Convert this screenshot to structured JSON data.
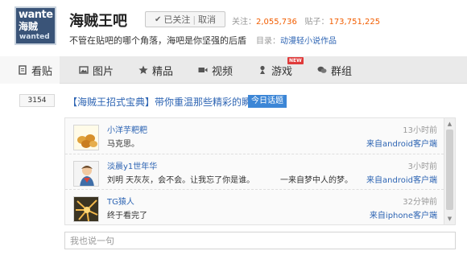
{
  "forum": {
    "logo_line1": "wante",
    "logo_line2": "海贼",
    "logo_line3": "wanted",
    "title": "海贼王吧",
    "follow_check": "✔",
    "follow_label": "已关注",
    "unfollow_label": "取消",
    "follow_sep": "|",
    "followers_label": "关注：",
    "followers": "2,055,736",
    "posts_label": "贴子：",
    "posts": "173,751,225",
    "slogan": "不管在贴吧的哪个角落，海吧是你坚强的后盾",
    "catalog_label": "目录：",
    "catalog": "动漫轻小说作品"
  },
  "nav": {
    "items": [
      {
        "label": "看贴",
        "icon": "document-icon"
      },
      {
        "label": "图片",
        "icon": "picture-icon"
      },
      {
        "label": "精品",
        "icon": "star-icon"
      },
      {
        "label": "视频",
        "icon": "video-icon"
      },
      {
        "label": "游戏",
        "icon": "game-icon"
      },
      {
        "label": "群组",
        "icon": "group-icon"
      }
    ],
    "badge": "NEW"
  },
  "thread": {
    "reply_count": "3154",
    "title": "【海贼王招式宝典】带你重温那些精彩的瞬间",
    "tag": "今日话题"
  },
  "comments": [
    {
      "user": "小洋芋粑粑",
      "text": "马克思。",
      "time": "13小时前",
      "client": "来自android客户端"
    },
    {
      "user": "淡晨y1世年华",
      "text": "刘明 天灰灰，会不会。让我忘了你是谁。          一来自梦中人的梦。",
      "time": "3小时前",
      "client": "来自android客户端"
    },
    {
      "user": "TG猿人",
      "text": "终于看完了",
      "time": "32分钟前",
      "client": "来自iphone客户端"
    }
  ],
  "scroll": {
    "up": "▲",
    "down": "▼"
  },
  "reply_box": {
    "placeholder": "我也说一句"
  },
  "colors": {
    "link": "#2d64b3",
    "stat_number": "#f25d00",
    "tag_bg": "#3c86d6",
    "badge": "#e03b3b",
    "nav_bg": "#eaeaea"
  }
}
